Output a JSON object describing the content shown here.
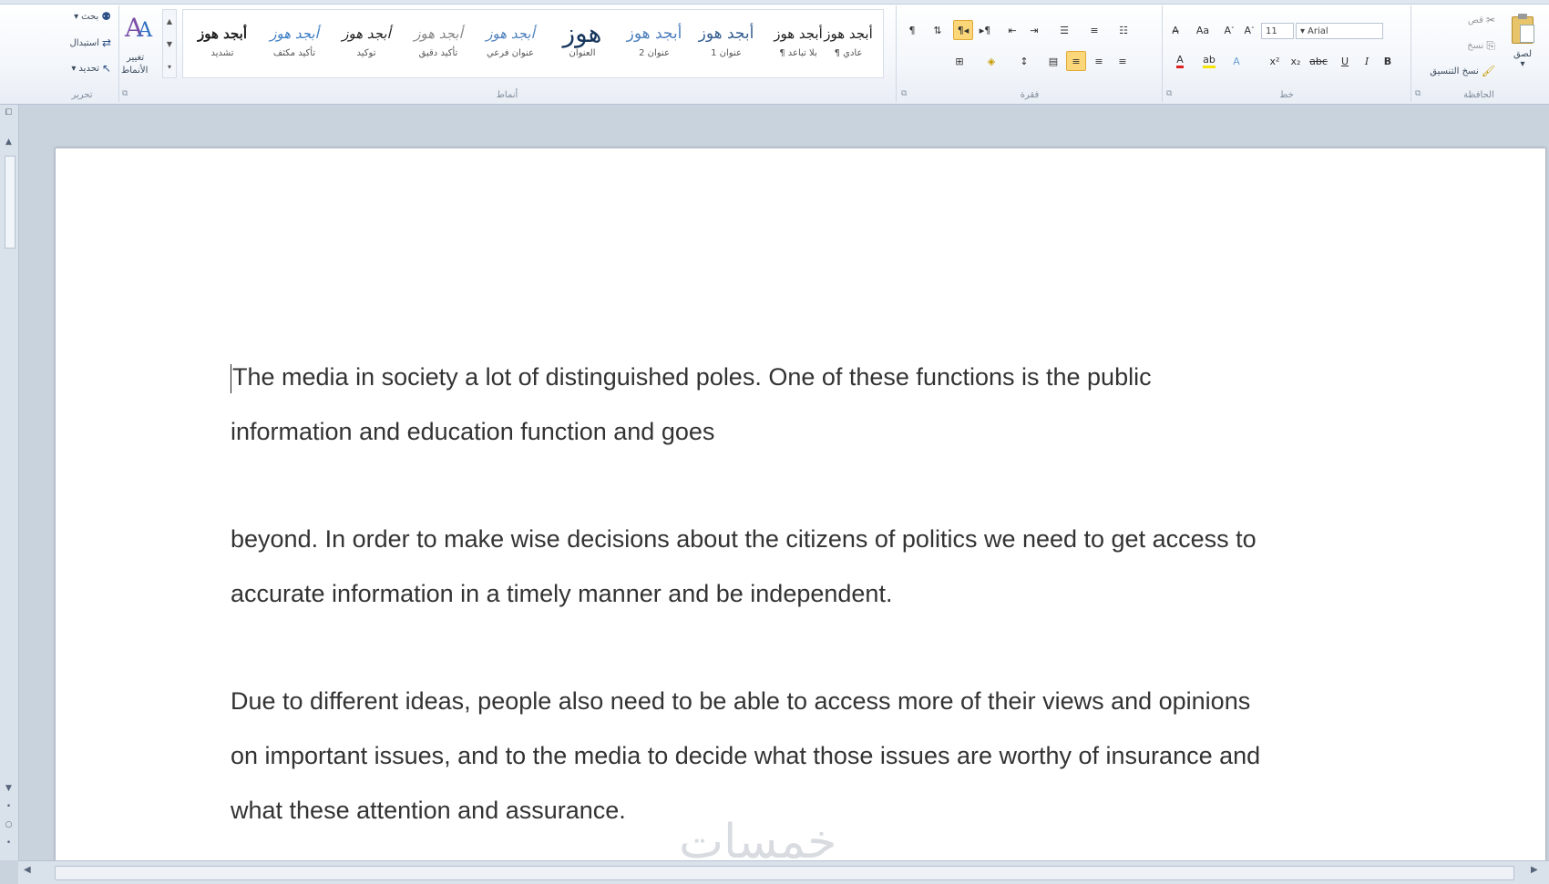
{
  "ribbon": {
    "editing": {
      "label": "تحرير",
      "find": "بحث",
      "replace": "استبدال",
      "select": "تحديد"
    },
    "change_styles": {
      "line1": "تغيير",
      "line2": "الأنماط"
    },
    "styles": {
      "label": "أنماط",
      "tiles": [
        {
          "sample": "أبجد هوز",
          "name": "تشديد"
        },
        {
          "sample": "أبجد هوز",
          "name": "تأكيد مكثف"
        },
        {
          "sample": "أبجد هوز",
          "name": "توكيد"
        },
        {
          "sample": "أبجد هوز",
          "name": "تأكيد دقيق"
        },
        {
          "sample": "أبجد هوز",
          "name": "عنوان فرعي"
        },
        {
          "sample": "هوز",
          "name": "العنوان"
        },
        {
          "sample": "أبجد هوز",
          "name": "عنوان 2"
        },
        {
          "sample": "أبجد هوز",
          "name": "عنوان 1"
        },
        {
          "sample": "أبجد هوز",
          "name": "¶ بلا تباعد"
        },
        {
          "sample": "أبجد هوز",
          "name": "¶ عادي"
        }
      ]
    },
    "paragraph": {
      "label": "فقرة"
    },
    "font": {
      "label": "خط",
      "font_name": "Arial",
      "font_size": "11"
    },
    "clipboard": {
      "label": "الحافظة",
      "paste": "لصق",
      "cut": "قص",
      "copy": "نسخ",
      "format_painter": "نسخ التنسيق"
    }
  },
  "document": {
    "paragraphs": [
      [
        "The media in society a lot of distinguished poles. One of these functions is the public",
        "information and education function and goes"
      ],
      [
        "beyond. In order to make wise decisions about the citizens of politics we need to get access to",
        "accurate information in a timely manner and be independent."
      ],
      [
        "Due to different ideas, people also need to be able to access more of their views and opinions",
        "on important issues, and to the media to decide what those issues are worthy of insurance and",
        "what these attention and assurance."
      ]
    ]
  },
  "watermark": "خمسات",
  "colors": {
    "accent": "#2c4f86",
    "active_button": "#fbd77a",
    "font_color_bar": "#e02020",
    "highlight_bar": "#f5e400"
  }
}
